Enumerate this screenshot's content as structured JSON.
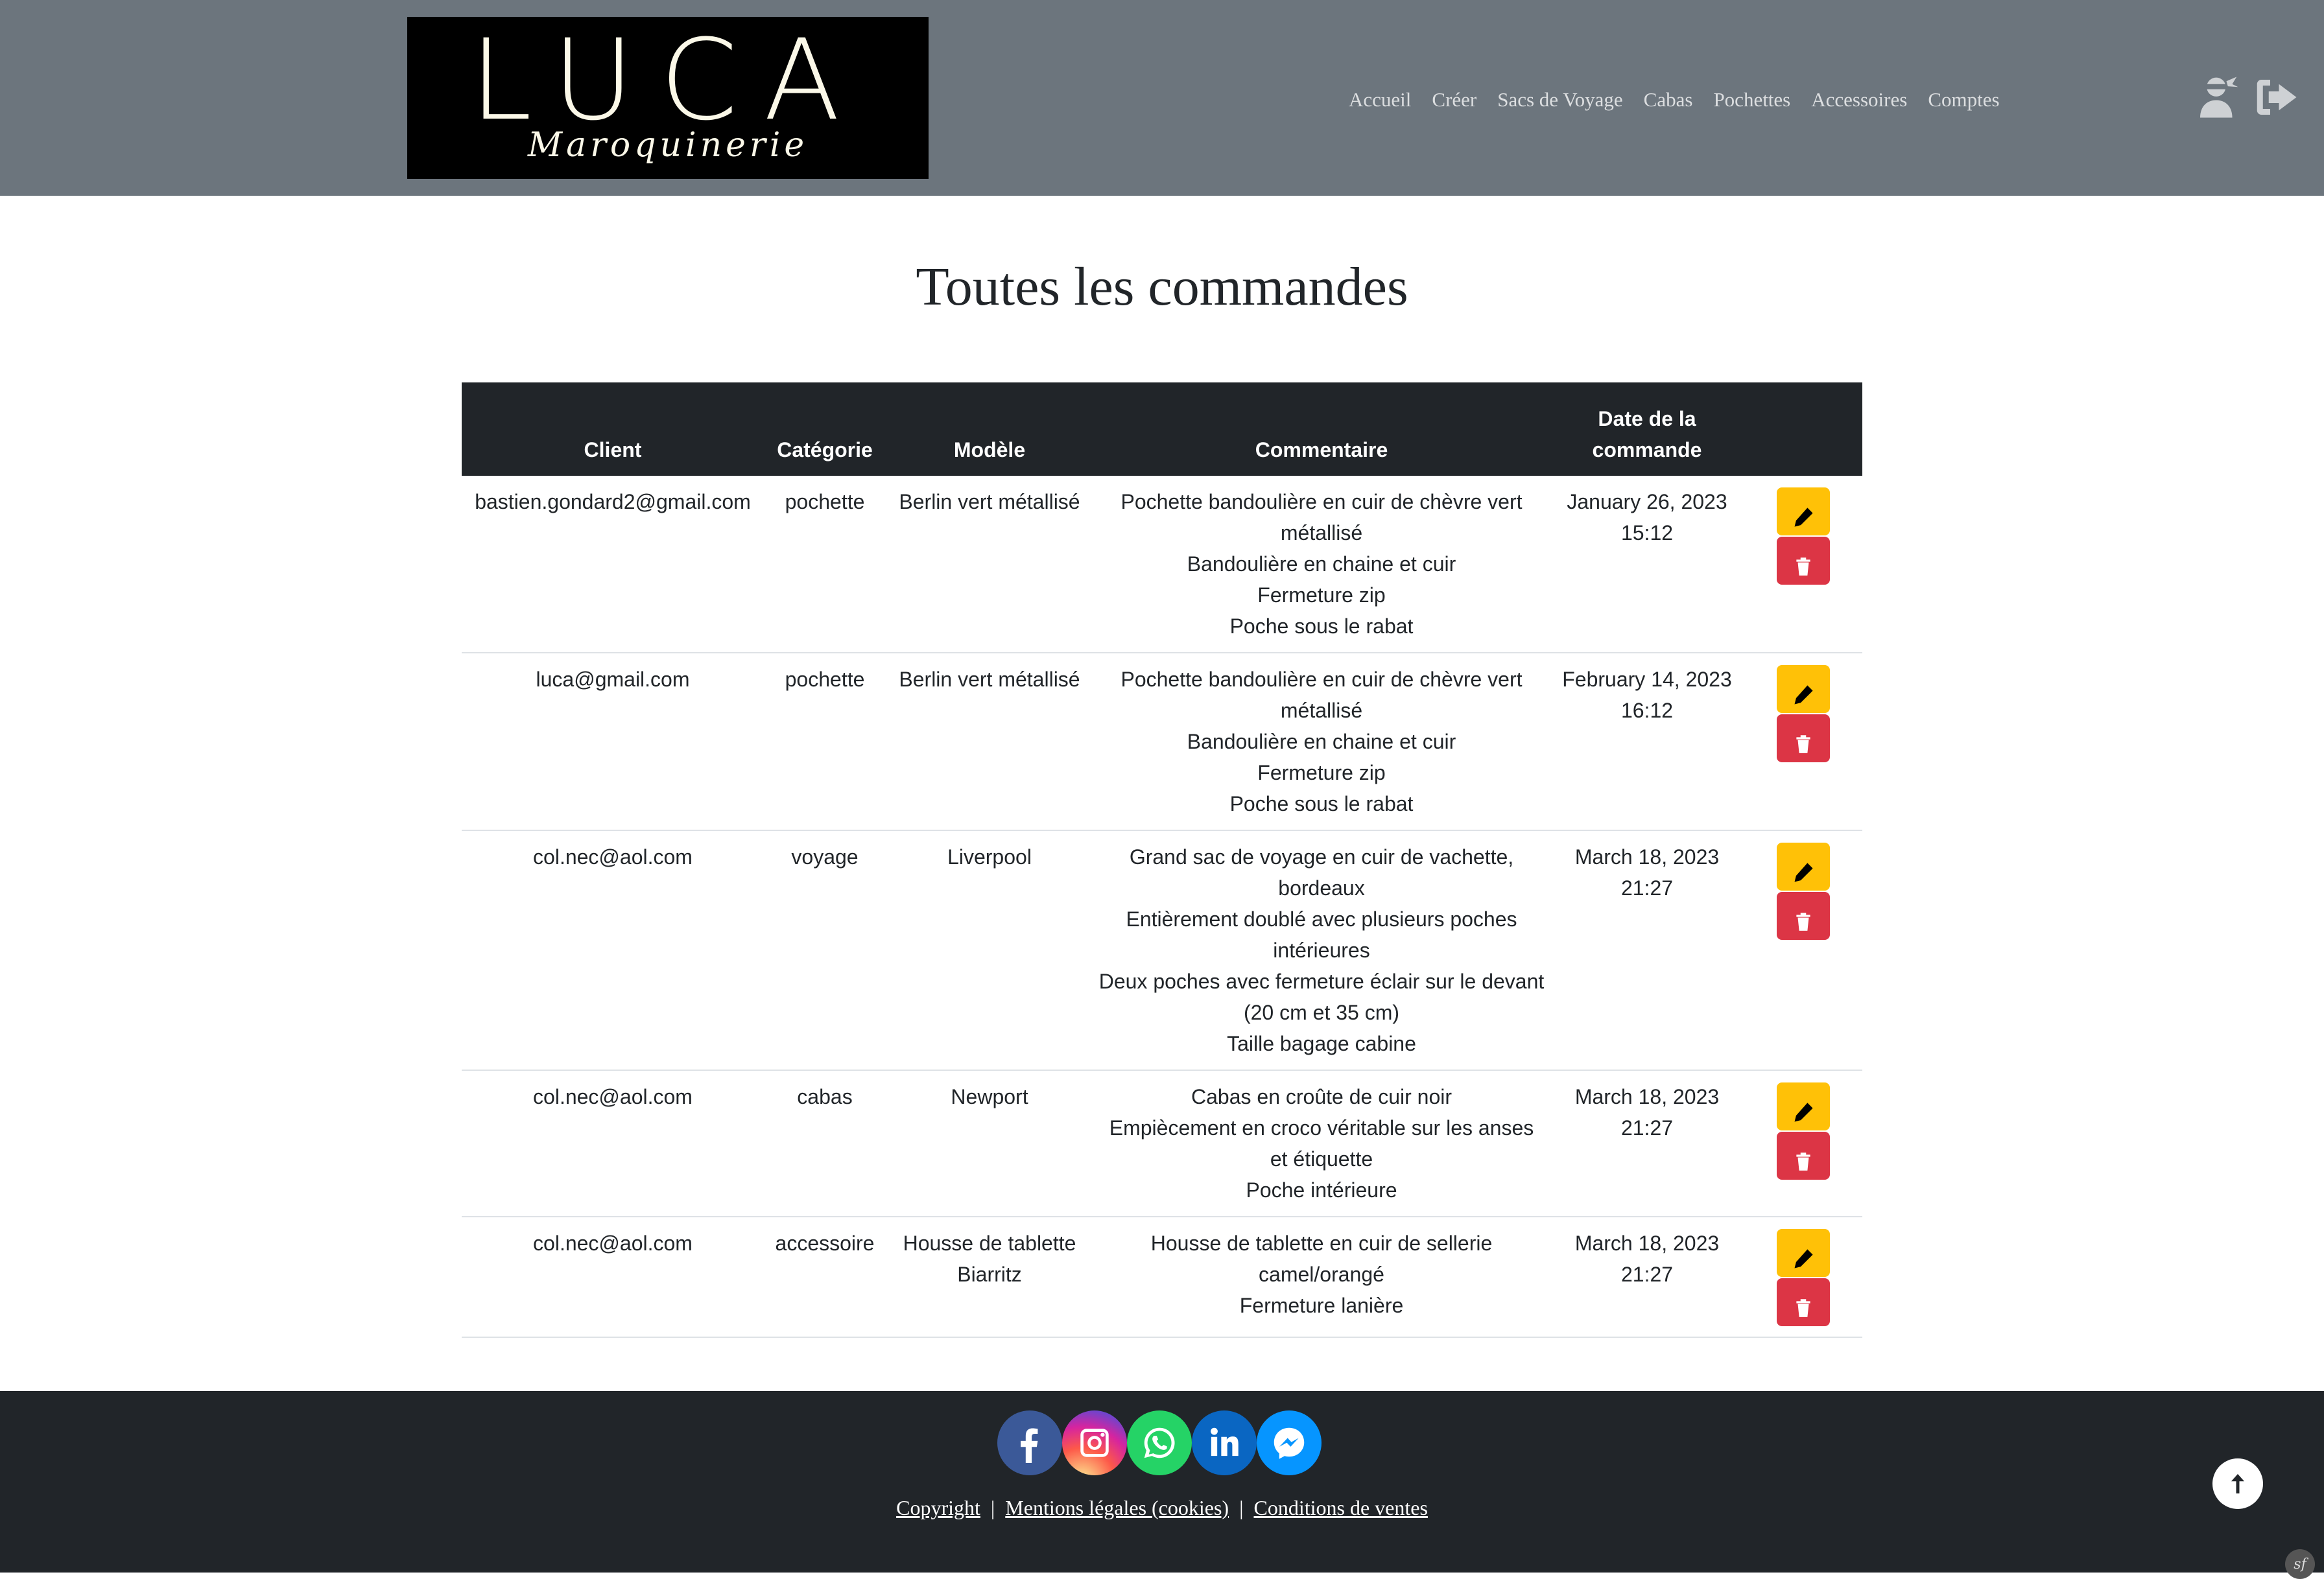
{
  "brand": {
    "logo_main": "LUCA",
    "logo_script": "Maroquinerie"
  },
  "nav": [
    {
      "label": "Accueil"
    },
    {
      "label": "Créer"
    },
    {
      "label": "Sacs de Voyage"
    },
    {
      "label": "Cabas"
    },
    {
      "label": "Pochettes"
    },
    {
      "label": "Accessoires"
    },
    {
      "label": "Comptes"
    }
  ],
  "header_icons": {
    "account": "user-ninja-icon",
    "logout": "sign-out-icon"
  },
  "page": {
    "title": "Toutes les commandes"
  },
  "table": {
    "headers": {
      "client": "Client",
      "category": "Catégorie",
      "model": "Modèle",
      "comment": "Commentaire",
      "date": "Date de la commande"
    },
    "rows": [
      {
        "client": "bastien.gondard2@gmail.com",
        "category": "pochette",
        "model": "Berlin vert métallisé",
        "comment": [
          "Pochette bandoulière en cuir de chèvre vert métallisé",
          "Bandoulière en chaine et cuir",
          "Fermeture zip",
          "Poche sous le rabat"
        ],
        "date": [
          "January 26, 2023",
          "15:12"
        ]
      },
      {
        "client": "luca@gmail.com",
        "category": "pochette",
        "model": "Berlin vert métallisé",
        "comment": [
          "Pochette bandoulière en cuir de chèvre vert métallisé",
          "Bandoulière en chaine et cuir",
          "Fermeture zip",
          "Poche sous le rabat"
        ],
        "date": [
          "February 14, 2023",
          "16:12"
        ]
      },
      {
        "client": "col.nec@aol.com",
        "category": "voyage",
        "model": "Liverpool",
        "comment": [
          "Grand sac de voyage en cuir de vachette, bordeaux",
          "Entièrement doublé avec plusieurs poches intérieures",
          "Deux poches avec fermeture éclair sur le devant (20 cm et 35 cm)",
          "Taille bagage cabine"
        ],
        "date": [
          "March 18, 2023",
          "21:27"
        ]
      },
      {
        "client": "col.nec@aol.com",
        "category": "cabas",
        "model": "Newport",
        "comment": [
          "Cabas en croûte de cuir noir",
          "Empiècement en croco véritable sur les anses et étiquette",
          "Poche intérieure"
        ],
        "date": [
          "March 18, 2023",
          "21:27"
        ]
      },
      {
        "client": "col.nec@aol.com",
        "category": "accessoire",
        "model": "Housse de tablette Biarritz",
        "comment": [
          "Housse de tablette en cuir de sellerie camel/orangé",
          "Fermeture lanière"
        ],
        "date": [
          "March 18, 2023",
          "21:27"
        ]
      }
    ],
    "actions": {
      "edit_icon": "pencil-icon",
      "delete_icon": "trash-icon",
      "edit_color": "#ffc107",
      "delete_color": "#dc3545"
    }
  },
  "footer": {
    "socials": [
      "facebook-icon",
      "instagram-icon",
      "whatsapp-icon",
      "linkedin-icon",
      "messenger-icon"
    ],
    "links": {
      "copyright": "Copyright",
      "legal": "Mentions légales (cookies)",
      "terms": "Conditions de ventes",
      "separator": "|"
    },
    "sf_badge": "sf"
  },
  "colors": {
    "header_bg": "#6c757d",
    "table_head_bg": "#212529",
    "footer_bg": "#212529"
  }
}
